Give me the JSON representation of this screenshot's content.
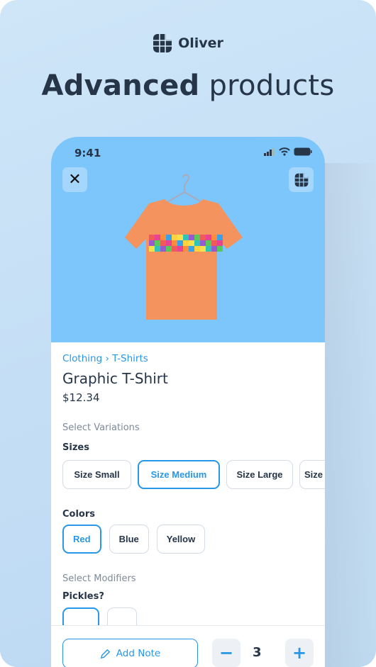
{
  "brand": {
    "name": "Oliver",
    "icon": "oliver-logo-icon"
  },
  "headline": {
    "bold": "Advanced",
    "regular": "products"
  },
  "status_bar": {
    "time": "9:41"
  },
  "product": {
    "breadcrumb": "Clothing › T-Shirts",
    "title": "Graphic T-Shirt",
    "price": "$12.34",
    "variations_label": "Select Variations",
    "sizes_label": "Sizes",
    "sizes": [
      "Size Small",
      "Size Medium",
      "Size Large",
      "Size"
    ],
    "selected_size": "Size Medium",
    "colors_label": "Colors",
    "colors": [
      "Red",
      "Blue",
      "Yellow"
    ],
    "selected_color": "Red",
    "modifiers_label": "Select Modifiers",
    "pickles_label": "Pickles?"
  },
  "footer": {
    "add_note": "Add Note",
    "quantity": "3",
    "minus": "−",
    "plus": "+"
  },
  "colors": {
    "accent": "#2797e6",
    "hero": "#7cc6fc",
    "text": "#263548"
  }
}
